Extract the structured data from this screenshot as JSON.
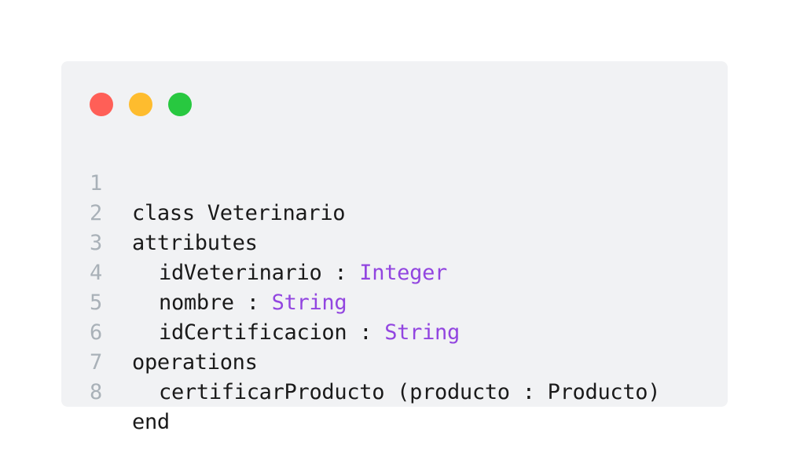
{
  "window": {
    "controls": [
      {
        "name": "close",
        "color": "#ff5f57"
      },
      {
        "name": "minimize",
        "color": "#febc2e"
      },
      {
        "name": "maximize",
        "color": "#28c840"
      }
    ]
  },
  "code": {
    "line_numbers": [
      "1",
      "2",
      "3",
      "4",
      "5",
      "6",
      "7",
      "8"
    ],
    "lines": [
      {
        "text": "class Veterinario"
      },
      {
        "text": "attributes"
      },
      {
        "text": "idVeterinario : ",
        "type": "Integer"
      },
      {
        "text": "nombre : ",
        "type": "String"
      },
      {
        "text": "idCertificacion : ",
        "type": "String"
      },
      {
        "text": "operations"
      },
      {
        "text": "certificarProducto (producto : Producto)"
      },
      {
        "text": "end"
      }
    ]
  },
  "colors": {
    "background": "#ffffff",
    "card": "#f1f2f4",
    "line_number": "#a9b1b8",
    "text": "#1a1a1a",
    "type_keyword": "#9245e0"
  }
}
